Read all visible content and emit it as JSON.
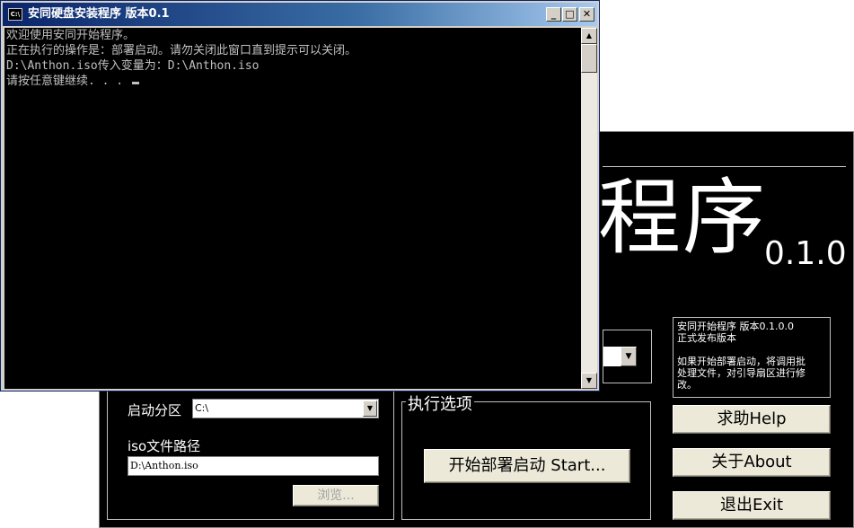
{
  "installer": {
    "big_title": "程序",
    "version": "0.1.0",
    "info": {
      "line1": "安同开始程序 版本0.1.0.0",
      "line2": "正式发布版本",
      "line3": "如果开始部署启动，将调用批",
      "line4": "处理文件，对引导扇区进行修",
      "line5": "改。"
    },
    "partition_label": "启动分区",
    "partition_value": "C:\\",
    "iso_label": "iso文件路径",
    "iso_value": "D:\\Anthon.iso",
    "browse_label": "浏览...",
    "options_legend": "执行选项",
    "start_label": "开始部署启动 Start...",
    "help_label": "求助Help",
    "about_label": "关于About",
    "exit_label": "退出Exit"
  },
  "console": {
    "title": "安同硬盘安装程序  版本0.1",
    "icon_text": "C:\\",
    "lines": [
      "欢迎使用安同开始程序。",
      "正在执行的操作是：部署启动。请勿关闭此窗口直到提示可以关闭。",
      "D:\\Anthon.iso传入变量为：D:\\Anthon.iso",
      "请按任意键继续. . . "
    ]
  },
  "colors": {
    "console_bg": "#000000",
    "titlebar_start": "#0a246a",
    "titlebar_end": "#a6caf0",
    "button_face": "#ece9d8"
  }
}
